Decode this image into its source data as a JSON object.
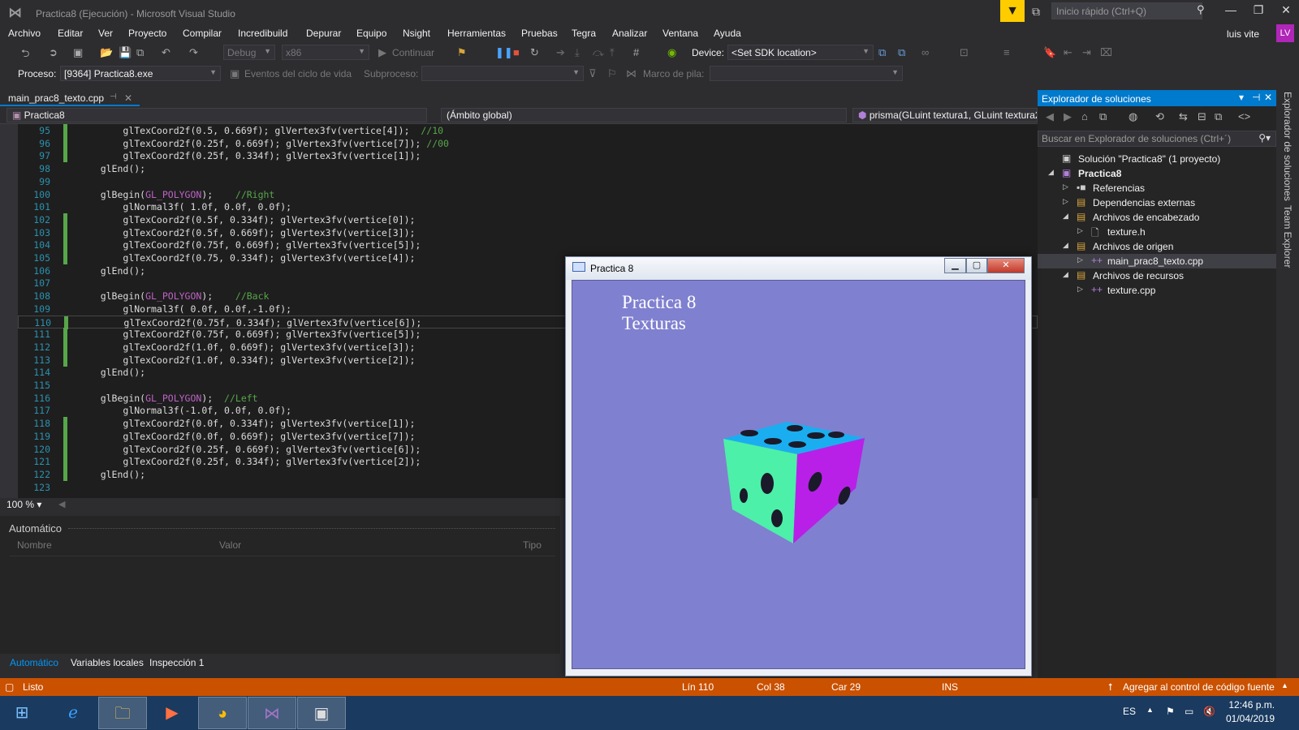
{
  "window": {
    "title": "Practica8 (Ejecución) - Microsoft Visual Studio",
    "quick_launch_placeholder": "Inicio rápido (Ctrl+Q)",
    "user": "luis vite",
    "avatar_initials": "LV"
  },
  "menu": [
    "Archivo",
    "Editar",
    "Ver",
    "Proyecto",
    "Compilar",
    "Incredibuild",
    "Depurar",
    "Equipo",
    "Nsight",
    "Herramientas",
    "Pruebas",
    "Tegra",
    "Analizar",
    "Ventana",
    "Ayuda"
  ],
  "toolbar": {
    "config": "Debug",
    "platform": "x86",
    "continue_label": "Continuar",
    "device_label": "Device:",
    "device_value": "<Set SDK location>"
  },
  "debug_toolbar": {
    "process_label": "Proceso:",
    "process_value": "[9364] Practica8.exe",
    "lifecycle_label": "Eventos del ciclo de vida",
    "thread_label": "Subproceso:",
    "stack_label": "Marco de pila:"
  },
  "document": {
    "tab": "main_prac8_texto.cpp",
    "nav_project": "Practica8",
    "nav_scope": "(Ámbito global)",
    "nav_member": "prisma(GLuint textura1, GLuint textura2"
  },
  "code_lines": [
    {
      "n": "95",
      "changed": true,
      "indent": "        ",
      "parts": [
        [
          "glTexCoord2f(0.5, 0.669f); glVertex3fv(vertice[4]);  ",
          ""
        ],
        [
          "//10",
          "comment"
        ]
      ]
    },
    {
      "n": "96",
      "changed": true,
      "indent": "        ",
      "parts": [
        [
          "glTexCoord2f(0.25f, 0.669f); glVertex3fv(vertice[7]); ",
          ""
        ],
        [
          "//00",
          "comment"
        ]
      ]
    },
    {
      "n": "97",
      "changed": true,
      "indent": "        ",
      "parts": [
        [
          "glTexCoord2f(0.25f, 0.334f); glVertex3fv(vertice[1]);",
          ""
        ]
      ]
    },
    {
      "n": "98",
      "changed": false,
      "indent": "    ",
      "parts": [
        [
          "glEnd();",
          ""
        ]
      ]
    },
    {
      "n": "99",
      "changed": false,
      "indent": "",
      "parts": []
    },
    {
      "n": "100",
      "changed": false,
      "indent": "    ",
      "parts": [
        [
          "glBegin(",
          ""
        ],
        [
          "GL_POLYGON",
          "const"
        ],
        [
          ");    ",
          ""
        ],
        [
          "//Right",
          "comment"
        ]
      ]
    },
    {
      "n": "101",
      "changed": false,
      "indent": "        ",
      "parts": [
        [
          "glNormal3f( 1.0f, 0.0f, 0.0f);",
          ""
        ]
      ]
    },
    {
      "n": "102",
      "changed": true,
      "indent": "        ",
      "parts": [
        [
          "glTexCoord2f(0.5f, 0.334f); glVertex3fv(vertice[0]);",
          ""
        ]
      ]
    },
    {
      "n": "103",
      "changed": true,
      "indent": "        ",
      "parts": [
        [
          "glTexCoord2f(0.5f, 0.669f); glVertex3fv(vertice[3]);",
          ""
        ]
      ]
    },
    {
      "n": "104",
      "changed": true,
      "indent": "        ",
      "parts": [
        [
          "glTexCoord2f(0.75f, 0.669f); glVertex3fv(vertice[5]);",
          ""
        ]
      ]
    },
    {
      "n": "105",
      "changed": true,
      "indent": "        ",
      "parts": [
        [
          "glTexCoord2f(0.75, 0.334f); glVertex3fv(vertice[4]);",
          ""
        ]
      ]
    },
    {
      "n": "106",
      "changed": false,
      "indent": "    ",
      "parts": [
        [
          "glEnd();",
          ""
        ]
      ]
    },
    {
      "n": "107",
      "changed": false,
      "indent": "",
      "parts": []
    },
    {
      "n": "108",
      "changed": false,
      "indent": "    ",
      "parts": [
        [
          "glBegin(",
          ""
        ],
        [
          "GL_POLYGON",
          "const"
        ],
        [
          ");    ",
          ""
        ],
        [
          "//Back",
          "comment"
        ]
      ]
    },
    {
      "n": "109",
      "changed": false,
      "indent": "        ",
      "parts": [
        [
          "glNormal3f( 0.0f, 0.0f,-1.0f);",
          ""
        ]
      ]
    },
    {
      "n": "110",
      "changed": true,
      "current": true,
      "indent": "        ",
      "parts": [
        [
          "glTexCoord2f(0.75f, 0.334f); glVertex3fv(vertice[6]);",
          ""
        ]
      ]
    },
    {
      "n": "111",
      "changed": true,
      "indent": "        ",
      "parts": [
        [
          "glTexCoord2f(0.75f, 0.669f); glVertex3fv(vertice[5]);",
          ""
        ]
      ]
    },
    {
      "n": "112",
      "changed": true,
      "indent": "        ",
      "parts": [
        [
          "glTexCoord2f(1.0f, 0.669f); glVertex3fv(vertice[3]);",
          ""
        ]
      ]
    },
    {
      "n": "113",
      "changed": true,
      "indent": "        ",
      "parts": [
        [
          "glTexCoord2f(1.0f, 0.334f); glVertex3fv(vertice[2]);",
          ""
        ]
      ]
    },
    {
      "n": "114",
      "changed": false,
      "indent": "    ",
      "parts": [
        [
          "glEnd();",
          ""
        ]
      ]
    },
    {
      "n": "115",
      "changed": false,
      "indent": "",
      "parts": []
    },
    {
      "n": "116",
      "changed": false,
      "indent": "    ",
      "parts": [
        [
          "glBegin(",
          ""
        ],
        [
          "GL_POLYGON",
          "const"
        ],
        [
          ");  ",
          ""
        ],
        [
          "//Left",
          "comment"
        ]
      ]
    },
    {
      "n": "117",
      "changed": false,
      "indent": "        ",
      "parts": [
        [
          "glNormal3f(-1.0f, 0.0f, 0.0f);",
          ""
        ]
      ]
    },
    {
      "n": "118",
      "changed": true,
      "indent": "        ",
      "parts": [
        [
          "glTexCoord2f(0.0f, 0.334f); glVertex3fv(vertice[1]);",
          ""
        ]
      ]
    },
    {
      "n": "119",
      "changed": true,
      "indent": "        ",
      "parts": [
        [
          "glTexCoord2f(0.0f, 0.669f); glVertex3fv(vertice[7]);",
          ""
        ]
      ]
    },
    {
      "n": "120",
      "changed": true,
      "indent": "        ",
      "parts": [
        [
          "glTexCoord2f(0.25f, 0.669f); glVertex3fv(vertice[6]);",
          ""
        ]
      ]
    },
    {
      "n": "121",
      "changed": true,
      "indent": "        ",
      "parts": [
        [
          "glTexCoord2f(0.25f, 0.334f); glVertex3fv(vertice[2]);",
          ""
        ]
      ]
    },
    {
      "n": "122",
      "changed": true,
      "indent": "    ",
      "parts": [
        [
          "glEnd();",
          ""
        ]
      ]
    },
    {
      "n": "123",
      "changed": false,
      "indent": "",
      "parts": []
    }
  ],
  "zoom": "100 %",
  "autos": {
    "title": "Automático",
    "columns": [
      "Nombre",
      "Valor",
      "Tipo"
    ],
    "tabs": [
      "Automático",
      "Variables locales",
      "Inspección 1"
    ]
  },
  "solution_explorer": {
    "title": "Explorador de soluciones",
    "search_placeholder": "Buscar en Explorador de soluciones (Ctrl+´)",
    "tree": [
      {
        "label": "Solución \"Practica8\" (1 proyecto)",
        "bold": false
      },
      {
        "label": "Practica8",
        "bold": true
      },
      {
        "label": "Referencias",
        "bold": false
      },
      {
        "label": "Dependencias externas",
        "bold": false
      },
      {
        "label": "Archivos de encabezado",
        "bold": false
      },
      {
        "label": "texture.h",
        "bold": false
      },
      {
        "label": "Archivos de origen",
        "bold": false
      },
      {
        "label": "main_prac8_texto.cpp",
        "bold": false,
        "selected": true
      },
      {
        "label": "Archivos de recursos",
        "bold": false
      },
      {
        "label": "texture.cpp",
        "bold": false
      }
    ]
  },
  "side_tabs": [
    "Explorador de soluciones",
    "Team Explorer"
  ],
  "app_window": {
    "title": "Practica 8",
    "line1": "Practica 8",
    "line2": "Texturas",
    "clear_color": "#8080d0",
    "cube_colors": {
      "top": "#1aaef0",
      "left": "#4df0a8",
      "right": "#b820e8",
      "pips": "#1a1a2a"
    }
  },
  "status": {
    "ready": "Listo",
    "line": "Lín 110",
    "col": "Col 38",
    "car": "Car 29",
    "mode": "INS",
    "source_control": "Agregar al control de código fuente"
  },
  "taskbar": {
    "lang": "ES",
    "time": "12:46 p.m.",
    "date": "01/04/2019"
  },
  "colors": {
    "accent": "#007acc",
    "status_bar": "#ca5100",
    "line_number": "#2b91af",
    "comment": "#57a64a",
    "change_marker": "#57a64a"
  }
}
